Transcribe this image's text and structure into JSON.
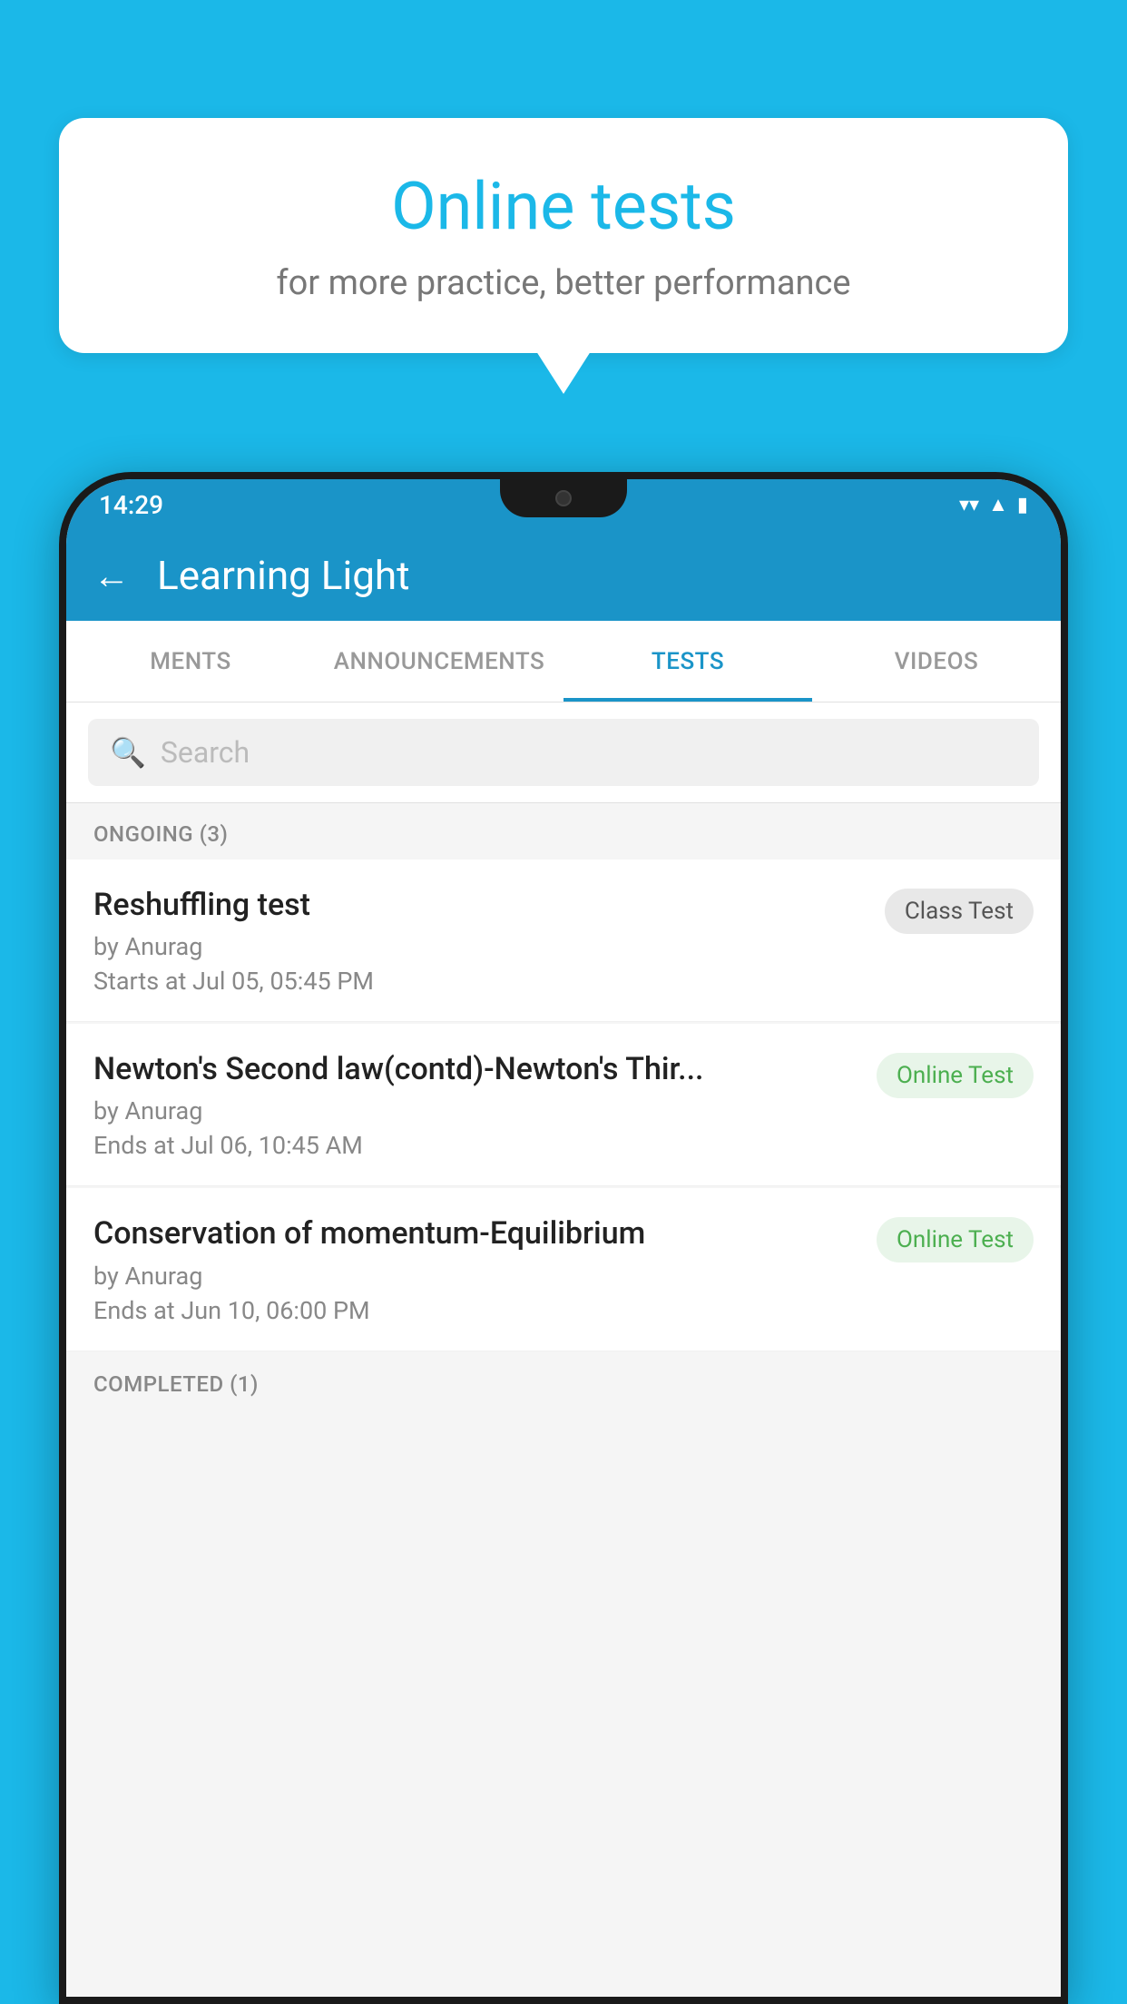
{
  "background_color": "#1BB8E8",
  "speech_bubble": {
    "title": "Online tests",
    "subtitle": "for more practice, better performance"
  },
  "phone": {
    "status_bar": {
      "time": "14:29",
      "icons": [
        "wifi",
        "signal",
        "battery"
      ]
    },
    "app_header": {
      "title": "Learning Light",
      "back_label": "←"
    },
    "tabs": [
      {
        "label": "MENTS",
        "active": false
      },
      {
        "label": "ANNOUNCEMENTS",
        "active": false
      },
      {
        "label": "TESTS",
        "active": true
      },
      {
        "label": "VIDEOS",
        "active": false
      }
    ],
    "search": {
      "placeholder": "Search"
    },
    "sections": [
      {
        "header": "ONGOING (3)",
        "items": [
          {
            "title": "Reshuffling test",
            "author": "by Anurag",
            "date": "Starts at  Jul 05, 05:45 PM",
            "badge": "Class Test",
            "badge_type": "class"
          },
          {
            "title": "Newton's Second law(contd)-Newton's Thir...",
            "author": "by Anurag",
            "date": "Ends at  Jul 06, 10:45 AM",
            "badge": "Online Test",
            "badge_type": "online"
          },
          {
            "title": "Conservation of momentum-Equilibrium",
            "author": "by Anurag",
            "date": "Ends at  Jun 10, 06:00 PM",
            "badge": "Online Test",
            "badge_type": "online"
          }
        ]
      },
      {
        "header": "COMPLETED (1)",
        "items": []
      }
    ]
  }
}
